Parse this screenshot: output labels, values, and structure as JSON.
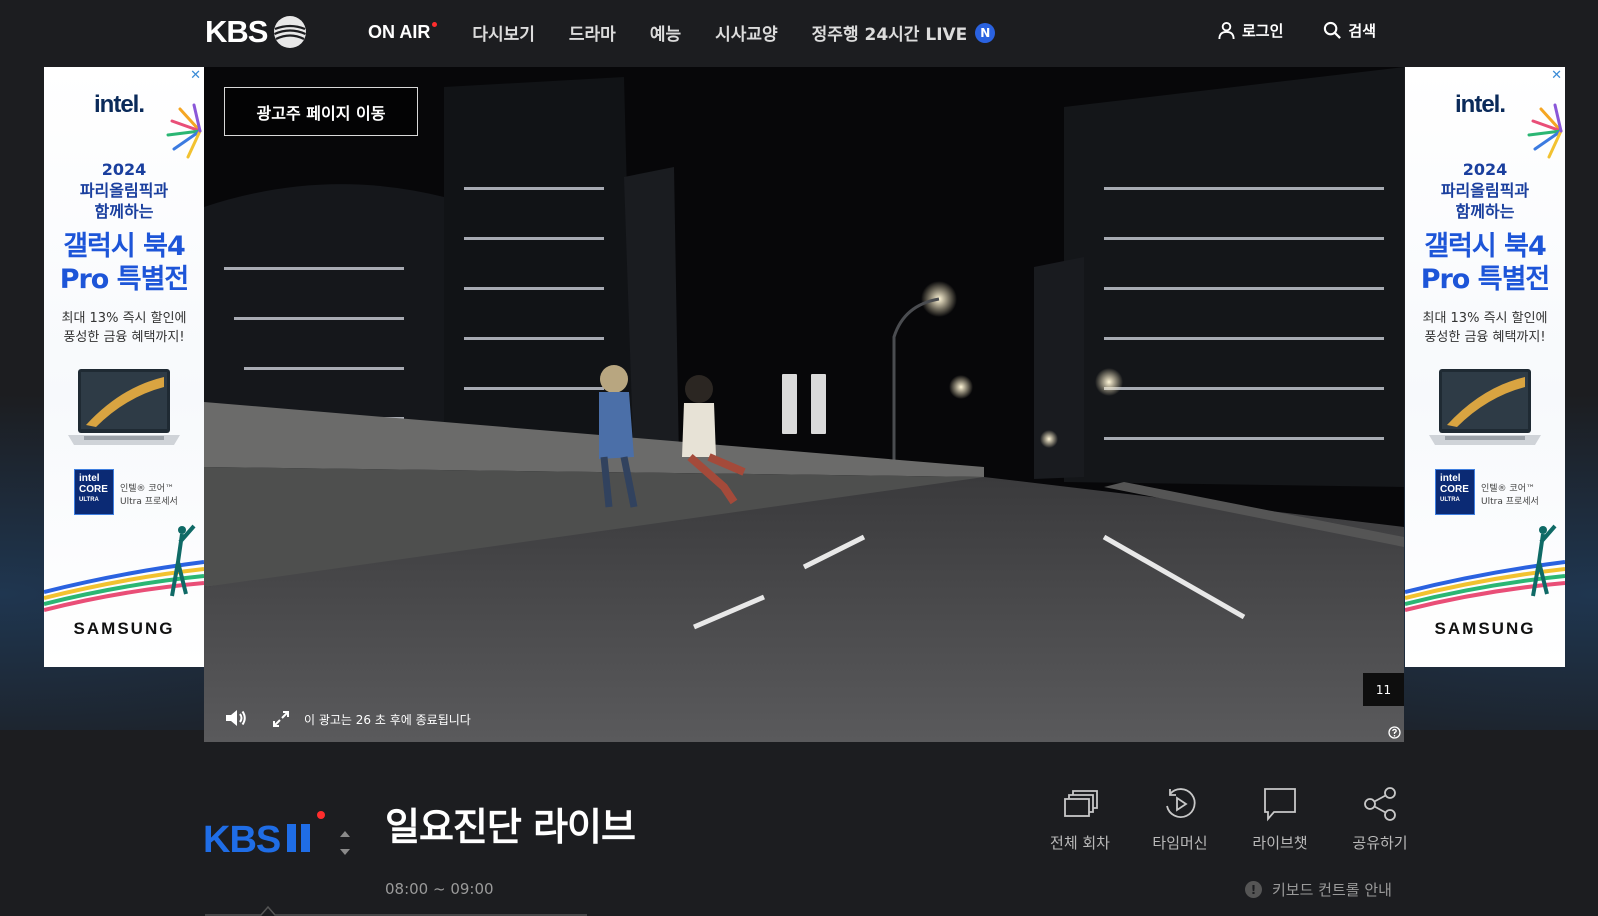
{
  "header": {
    "logo_text": "KBS",
    "nav": [
      {
        "label": "ON AIR"
      },
      {
        "label": "다시보기"
      },
      {
        "label": "드라마"
      },
      {
        "label": "예능"
      },
      {
        "label": "시사교양"
      },
      {
        "label": "정주행 24시간 LIVE",
        "badge": "N"
      }
    ],
    "login_label": "로그인",
    "search_label": "검색"
  },
  "side_ad": {
    "close": "✕",
    "brand": "intel.",
    "year_lines": [
      "2024",
      "파리올림픽과",
      "함께하는"
    ],
    "headline_lines": [
      "갤럭시 북4",
      "Pro 특별전"
    ],
    "sub_lines": [
      "최대 13% 즉시 할인에",
      "풍성한 금융 혜택까지!"
    ],
    "core_badge_lines": [
      "intel",
      "CORE",
      "ULTRA"
    ],
    "core_text_lines": [
      "인텔® 코어™",
      "Ultra 프로세서"
    ],
    "sponsor": "SAMSUNG"
  },
  "player": {
    "advertiser_button": "광고주 페이지 이동",
    "ad_countdown": "이 광고는 26 초 후에 종료됩니다",
    "skip_counter": "11"
  },
  "program": {
    "channel": "KBS 1",
    "title": "일요진단 라이브",
    "time": "08:00 ~ 09:00",
    "actions": [
      {
        "label": "전체 회차",
        "icon": "episodes-icon"
      },
      {
        "label": "타임머신",
        "icon": "timemachine-icon"
      },
      {
        "label": "라이브챗",
        "icon": "chat-icon"
      },
      {
        "label": "공유하기",
        "icon": "share-icon"
      }
    ],
    "keyboard_help": "키보드 컨트롤 안내"
  },
  "colors": {
    "background": "#1c1d20",
    "accent_blue": "#2a62e0",
    "live_red": "#ff2d2d",
    "ad_headline_blue": "#1d55d8"
  }
}
